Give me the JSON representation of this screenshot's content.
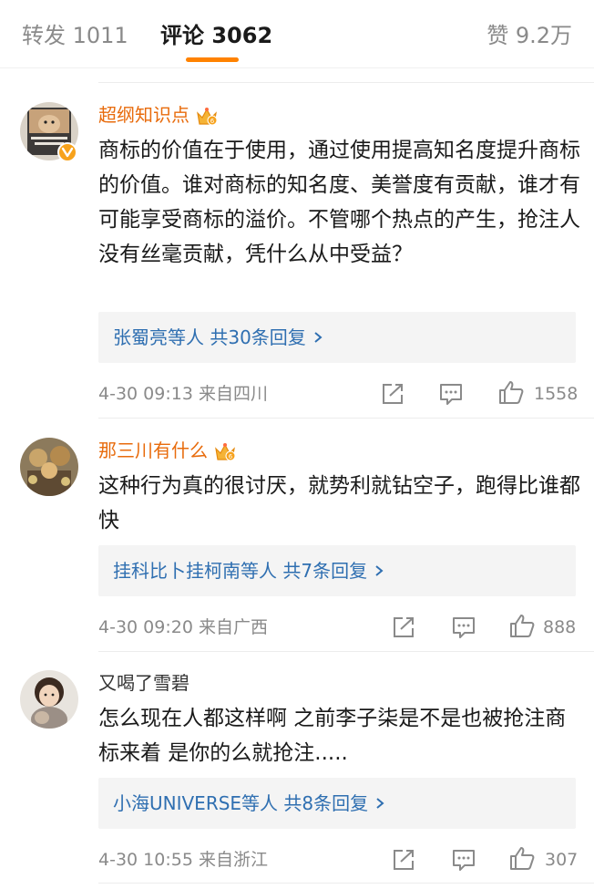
{
  "tabs": {
    "repost": "转发 1011",
    "comments": "评论 3062",
    "likes": "赞 9.2万"
  },
  "colors": {
    "accent": "#ff8200",
    "vip_name": "#e86b0c",
    "link": "#2f6fb1",
    "meta": "#8a8a8a"
  },
  "comments": [
    {
      "username": "超纲知识点",
      "verified": true,
      "vip_crown": true,
      "text": "商标的价值在于使用，通过使用提高知名度提升商标的价值。谁对商标的知名度、美誉度有贡献，谁才有可能享受商标的溢价。不管哪个热点的产生，抢注人没有丝毫贡献，凭什么从中受益？",
      "replies_user": "张蜀亮",
      "replies_etc": "等人",
      "replies_count": "共30条回复",
      "time_location": "4-30 09:13 来自四川",
      "likes": "1558",
      "icons": [
        "share-icon",
        "comment-icon",
        "like-icon",
        "chevron-right-icon"
      ]
    },
    {
      "username": "那三川有什么",
      "verified": false,
      "vip_crown": true,
      "text": "这种行为真的很讨厌，就势利就钻空子，跑得比谁都快",
      "replies_user": "挂科比卜挂柯南",
      "replies_etc": "等人",
      "replies_count": "共7条回复",
      "time_location": "4-30 09:20 来自广西",
      "likes": "888"
    },
    {
      "username": "又喝了雪碧",
      "verified": false,
      "vip_crown": false,
      "text": "怎么现在人都这样啊 之前李子柒是不是也被抢注商标来着 是你的么就抢注.....",
      "replies_user": "小海UNIVERSE",
      "replies_etc": "等人",
      "replies_count": "共8条回复",
      "time_location": "4-30 10:55 来自浙江",
      "likes": "307"
    }
  ]
}
